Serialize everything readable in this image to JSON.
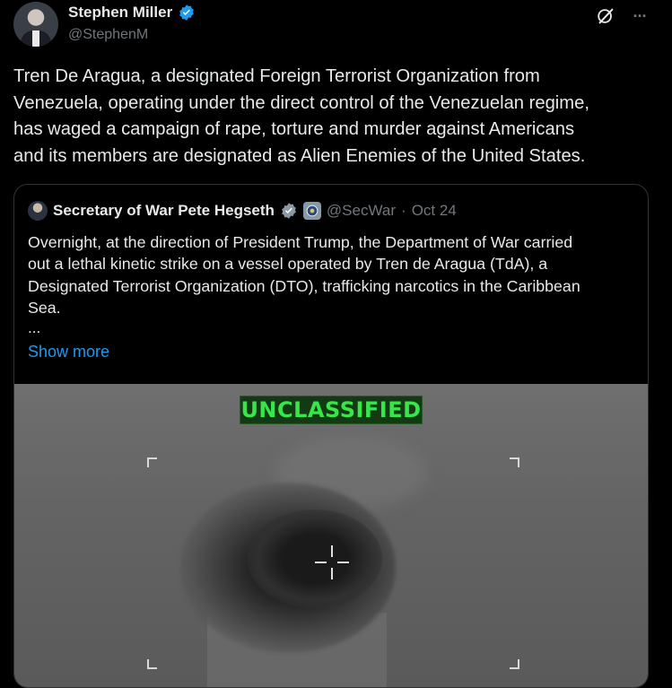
{
  "author": {
    "display_name": "Stephen Miller",
    "handle": "@StephenM"
  },
  "tweet": {
    "text": "Tren De Aragua, a designated Foreign Terrorist Organization from\nVenezuela, operating under the direct control of the Venezuelan regime,\nhas waged a campaign of rape, torture and murder against Americans\nand its members are designated as Alien Enemies of the United States."
  },
  "icons": {
    "verified": "verified-badge-icon",
    "grok": "grok-icon",
    "more": "more-icon",
    "gov": "government-badge-icon",
    "reticle": "crosshair-icon"
  },
  "top_actions": {
    "more": "···"
  },
  "quote": {
    "display_name": "Secretary of War Pete Hegseth",
    "handle": "@SecWar",
    "separator": "·",
    "date": "Oct 24",
    "text": "Overnight, at the direction of President Trump, the Department of War carried\nout a lethal kinetic strike on a vessel operated by Tren de Aragua (TdA), a\nDesignated Terrorist Organization (DTO), trafficking narcotics in the Caribbean\nSea.",
    "ellipsis": "...",
    "show_more": "Show more",
    "media_overlay_label": "UNCLASSIFIED"
  },
  "colors": {
    "background": "#000000",
    "text": "#e7e9ea",
    "secondary_text": "#71767b",
    "link": "#1d9bf0",
    "verified": "#1d9bf0",
    "unclassified_text": "#36e64a"
  }
}
